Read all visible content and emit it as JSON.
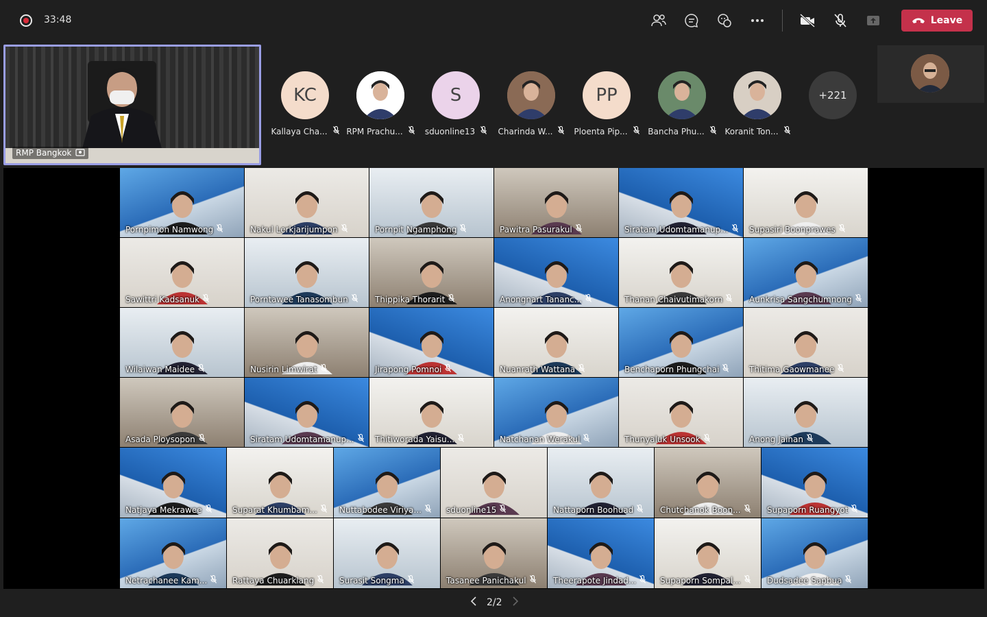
{
  "meeting": {
    "timer": "33:48",
    "leave_label": "Leave",
    "accent_leave": "#c4314b",
    "recording_color": "#d92c3a"
  },
  "toolbar": {
    "icons": [
      "participants-icon",
      "chat-icon",
      "reactions-icon",
      "more-options-icon",
      "camera-off-icon",
      "mic-off-icon",
      "share-icon"
    ]
  },
  "active_speaker": {
    "name": "RMP Bangkok"
  },
  "roster": [
    {
      "initials": "KC",
      "name": "Kallaya Cha...",
      "color": "#f4dccb",
      "photo": false
    },
    {
      "initials": "",
      "name": "RPM Prachu...",
      "color": "#ffffff",
      "photo": true
    },
    {
      "initials": "S",
      "name": "sduonline13",
      "color": "#ebd3ea",
      "photo": false
    },
    {
      "initials": "",
      "name": "Charinda W...",
      "color": "#8a6a55",
      "photo": true
    },
    {
      "initials": "PP",
      "name": "Ploenta Pip...",
      "color": "#f4dccb",
      "photo": false
    },
    {
      "initials": "",
      "name": "Bancha Phu...",
      "color": "#6a8a6a",
      "photo": true
    },
    {
      "initials": "",
      "name": "Koranit Ton...",
      "color": "#d8cfc4",
      "photo": true
    }
  ],
  "overflow_count": "+221",
  "gallery": [
    "Pornpimon Namwong",
    "Nakul Lerkjarijumpon",
    "Pornpit Ngamphong",
    "Pawitra Pasurakul",
    "Siratam Udomtamanup...",
    "Supasiri Boonprawes",
    "Sawittri Kadsanuk",
    "Porntawee Tanasombun",
    "Thippika Thorarit",
    "Anongnart Tananc...",
    "Thanan Chaivutimakorn",
    "Aunkrisa Sangchumnong",
    "Wilaiwan Maidee",
    "Nusirin Limwirat",
    "Jirapong Pomnoi",
    "Nuanrath Wattana",
    "Benchaporn Phungchai",
    "Thitima Gaowmanee",
    "Asada Ploysopon",
    "Siratam Udomtamanup...",
    "Thitiworada Yaisu...",
    "Natchanan Werakul",
    "Thunyaluk Unsook",
    "Anong Jainan",
    "Natjaya Mekrawee",
    "Suparat Khumbam...",
    "Nuttabodee Viriya...",
    "sduonline15",
    "Nattaporn Boohuad",
    "Chutchanok Boon...",
    "Supaporn Ruangyot",
    "Netrachanee Kam...",
    "Rattaya Chuarklang",
    "Surasit Songma",
    "Tasanee Panichakul",
    "Theerapote Jindad...",
    "Supaporn Sompal...",
    "Dudsadee Sapbua"
  ],
  "pager": {
    "label": "2/2"
  }
}
